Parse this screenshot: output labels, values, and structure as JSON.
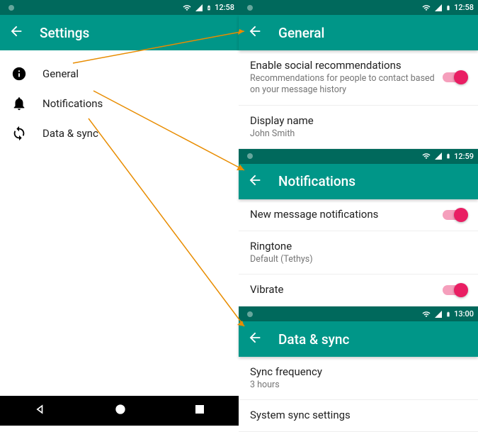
{
  "left": {
    "status": {
      "time": "12:58"
    },
    "toolbar": {
      "title": "Settings"
    },
    "items": [
      {
        "label": "General"
      },
      {
        "label": "Notifications"
      },
      {
        "label": "Data & sync"
      }
    ]
  },
  "right": {
    "general": {
      "status_time": "12:58",
      "title": "General",
      "items": [
        {
          "title": "Enable social recommendations",
          "sub": "Recommendations for people to contact based on your message history"
        },
        {
          "title": "Display name",
          "sub": "John Smith"
        }
      ]
    },
    "notifications": {
      "status_time": "12:59",
      "title": "Notifications",
      "items": [
        {
          "title": "New message notifications"
        },
        {
          "title": "Ringtone",
          "sub": "Default (Tethys)"
        },
        {
          "title": "Vibrate"
        }
      ]
    },
    "datasync": {
      "status_time": "13:00",
      "title": "Data & sync",
      "items": [
        {
          "title": "Sync frequency",
          "sub": "3 hours"
        },
        {
          "title": "System sync settings"
        }
      ]
    }
  }
}
